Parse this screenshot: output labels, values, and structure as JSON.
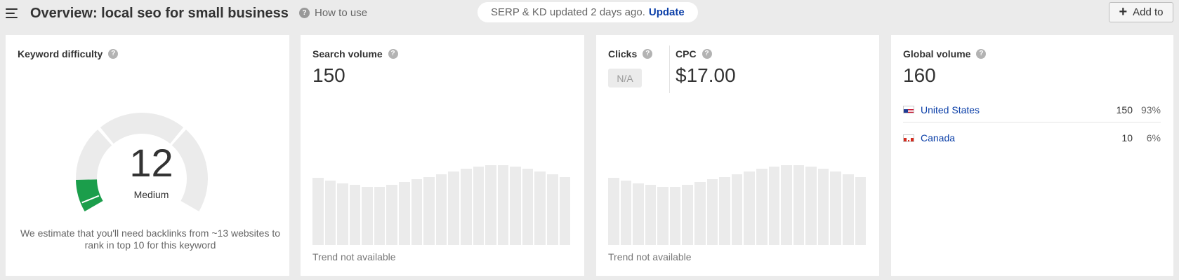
{
  "header": {
    "title": "Overview: local seo for small business",
    "how_to_use": "How to use",
    "update_status": "SERP & KD updated 2 days ago.",
    "update_link": "Update",
    "add_to": "Add to"
  },
  "kd_card": {
    "label": "Keyword difficulty",
    "value": "12",
    "level": "Medium",
    "description": "We estimate that you'll need backlinks from ~13 websites to rank in top 10 for this keyword",
    "accent_color": "#1b9e4b",
    "fill_fraction": 0.12
  },
  "sv_card": {
    "label": "Search volume",
    "value": "150",
    "trend": "Trend not available"
  },
  "clicks_card": {
    "clicks_label": "Clicks",
    "clicks_value": "N/A",
    "cpc_label": "CPC",
    "cpc_value": "$17.00",
    "trend": "Trend not available"
  },
  "gv_card": {
    "label": "Global volume",
    "value": "160",
    "countries": [
      {
        "name": "United States",
        "volume": "150",
        "percent": "93%",
        "flag": "us-flag-icon"
      },
      {
        "name": "Canada",
        "volume": "10",
        "percent": "6%",
        "flag": "ca-flag-icon"
      }
    ]
  },
  "placeholder_trend": [
    74,
    71,
    68,
    66,
    64,
    64,
    66,
    69,
    72,
    75,
    78,
    81,
    84,
    86,
    88,
    88,
    86,
    84,
    81,
    78,
    75
  ]
}
